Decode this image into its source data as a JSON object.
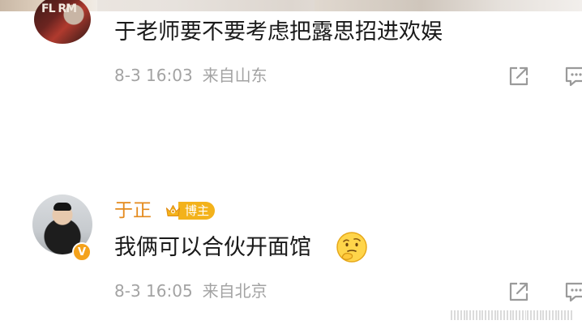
{
  "comments": [
    {
      "text": "于老师要不要考虑把露思招进欢娱",
      "date": "8-3",
      "time": "16:03",
      "source": "来自山东",
      "avatar_text": "FL RM"
    },
    {
      "username": "于正",
      "badge": "博主",
      "text": "我俩可以合伙开面馆",
      "emoji": "thinking-face-emoji",
      "date": "8-3",
      "time": "16:05",
      "source": "来自北京",
      "verified_mark": "V"
    }
  ],
  "colors": {
    "username": "#e48a1c",
    "badge_bg": "#f3b21b",
    "meta_text": "#a3a3a3",
    "verified_badge": "#f4a21c"
  },
  "icons": [
    "share-icon",
    "comment-icon",
    "crown-icon"
  ]
}
